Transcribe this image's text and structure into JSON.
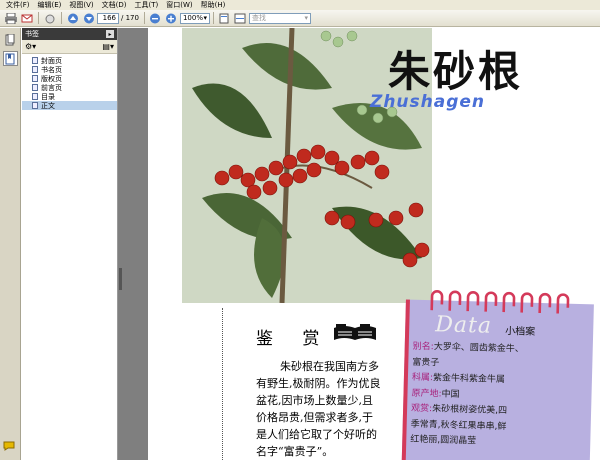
{
  "menu": [
    "文件(F)",
    "编辑(E)",
    "视图(V)",
    "文档(D)",
    "工具(T)",
    "窗口(W)",
    "帮助(H)"
  ],
  "toolbar": {
    "page_current": "166",
    "page_total": "/ 170",
    "zoom": "100%",
    "find_placeholder": "查找"
  },
  "bookmarks": {
    "title": "书签",
    "items": [
      "封面页",
      "书名页",
      "版权页",
      "前言页",
      "目录",
      "正文"
    ],
    "selected": "正文"
  },
  "document": {
    "title_cn": "朱砂根",
    "title_en": "Zhushagen",
    "section_heading": "鉴 赏",
    "body_lines": [
      "朱砂根在我国南方多",
      "有野生,极耐阴。作为优良",
      "盆花,因市场上数量少,且",
      "价格昂贵,但需求者多,于",
      "是人们给它取了个好听的",
      "名字“富贵子”。"
    ],
    "card": {
      "data_word": "Data",
      "label": "小档案",
      "lines": [
        {
          "k": "别名:",
          "v": "大罗伞、圆齿紫金牛、"
        },
        {
          "k": "",
          "v": "富贵子"
        },
        {
          "k": "科属:",
          "v": "紫金牛科紫金牛属"
        },
        {
          "k": "原产地:",
          "v": "中国"
        },
        {
          "k": "观赏:",
          "v": "朱砂根树姿优美,四"
        },
        {
          "k": "",
          "v": "季常青,秋冬红果串串,鲜"
        },
        {
          "k": "",
          "v": "红艳丽,圆润晶莹"
        }
      ]
    }
  },
  "colors": {
    "title_en": "#4a6fd6",
    "card_bg": "#b8b0e0",
    "card_key": "#a8207a",
    "ring": "#d43a5a"
  }
}
